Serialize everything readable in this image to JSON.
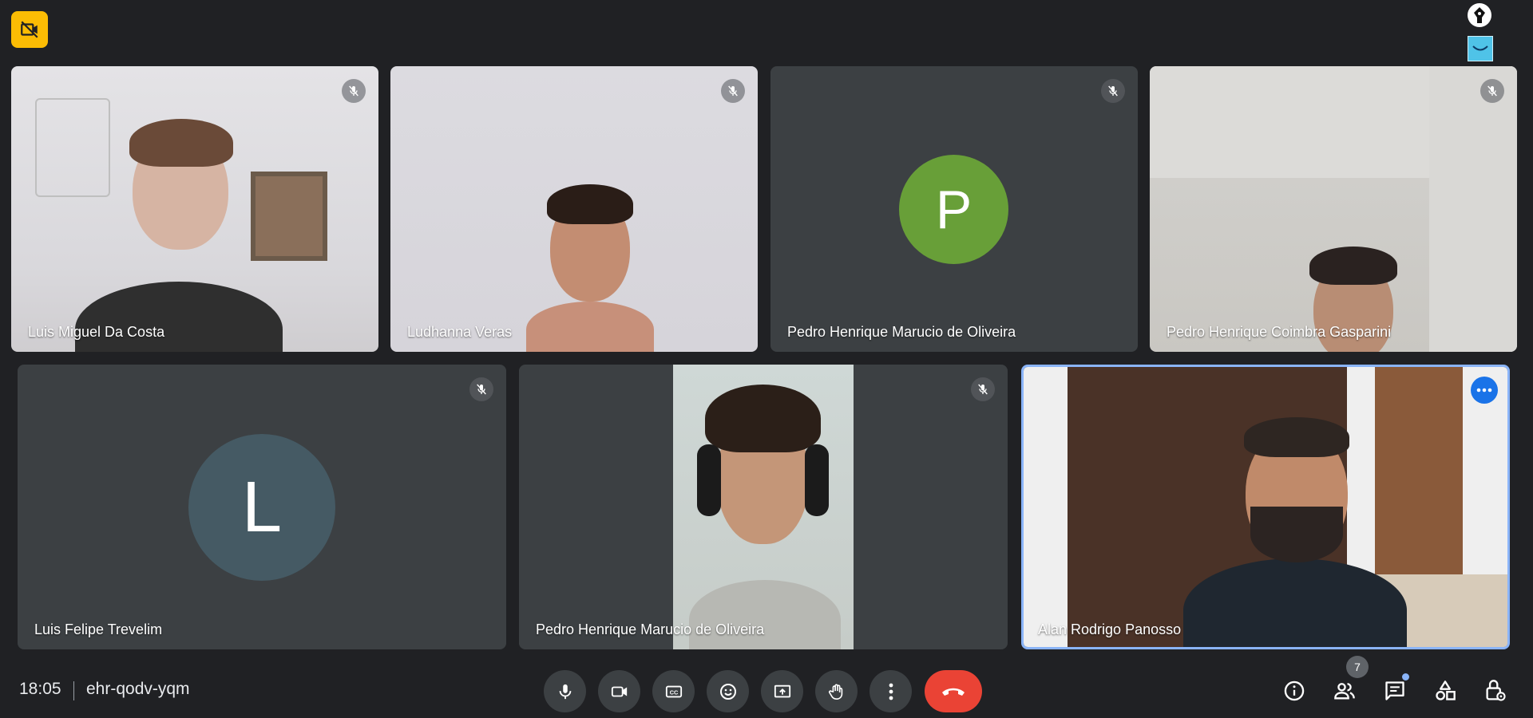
{
  "meeting": {
    "time": "18:05",
    "code": "ehr-qodv-yqm",
    "participant_count": "7"
  },
  "participants": [
    {
      "name": "Luis Miguel Da Costa",
      "muted": true,
      "video": true
    },
    {
      "name": "Ludhanna Veras",
      "muted": true,
      "video": true
    },
    {
      "name": "Pedro Henrique Marucio de Oliveira",
      "muted": true,
      "video": false,
      "avatar_letter": "P",
      "avatar_color": "#689f38"
    },
    {
      "name": "Pedro Henrique Coimbra Gasparini",
      "muted": true,
      "video": true
    },
    {
      "name": "Luis Felipe Trevelim",
      "muted": true,
      "video": false,
      "avatar_letter": "L",
      "avatar_color": "#455a64"
    },
    {
      "name": "Pedro Henrique Marucio de Oliveira",
      "muted": true,
      "video": true
    },
    {
      "name": "Alan Rodrigo Panosso",
      "muted": false,
      "video": true,
      "speaking": true
    }
  ],
  "controls": [
    "microphone-icon",
    "camera-icon",
    "captions-icon",
    "emoji-icon",
    "present-screen-icon",
    "raise-hand-icon",
    "more-options-icon",
    "hang-up-icon"
  ],
  "right_controls": [
    "info-icon",
    "people-icon",
    "chat-icon",
    "activities-icon",
    "host-controls-icon"
  ],
  "colors": {
    "background": "#202124",
    "tile": "#3c4043",
    "accent": "#1a73e8",
    "end_call": "#ea4335",
    "badge": "#fbbc04"
  }
}
